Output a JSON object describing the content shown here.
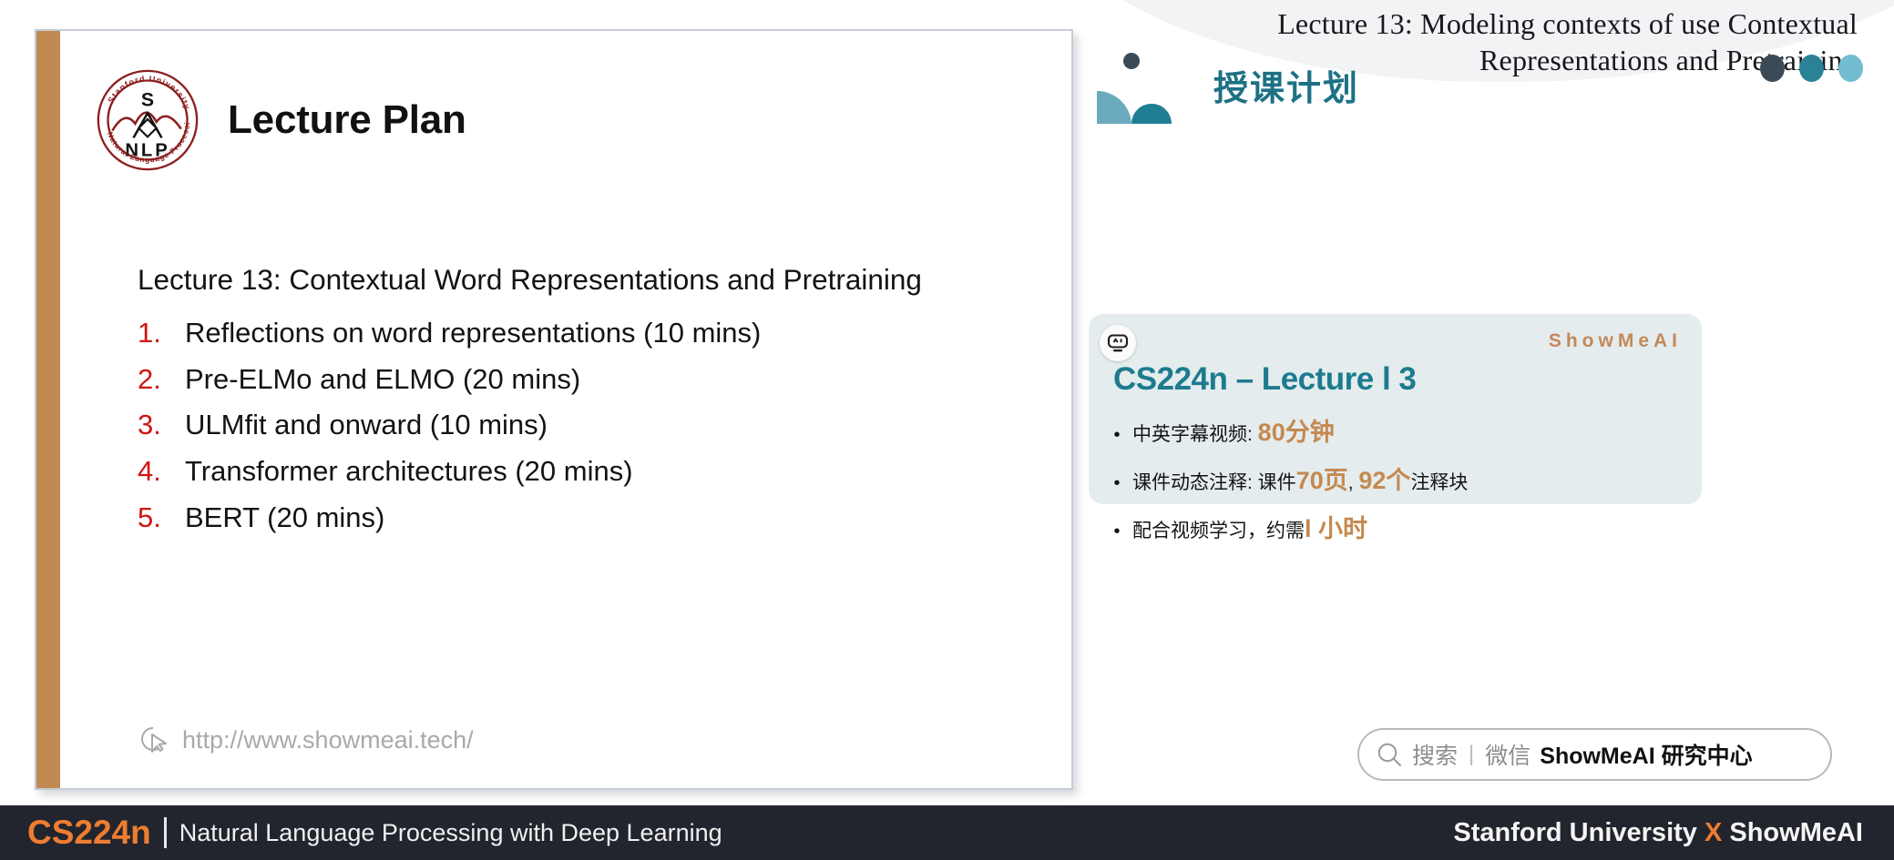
{
  "slide": {
    "title": "Lecture Plan",
    "logo_alt": "stanford-nlp-logo",
    "lead_line": "Lecture 13: Contextual Word Representations and Pretraining",
    "agenda": [
      {
        "num": "1.",
        "text": "Reflections on word representations (10 mins)"
      },
      {
        "num": "2.",
        "text": "Pre-ELMo and ELMO (20 mins)"
      },
      {
        "num": "3.",
        "text": "ULMfit and onward (10 mins)"
      },
      {
        "num": "4.",
        "text": "Transformer architectures (20 mins)"
      },
      {
        "num": "5.",
        "text": "BERT (20 mins)"
      }
    ],
    "url": "http://www.showmeai.tech/",
    "accent_color": "#c08a52"
  },
  "right_panel": {
    "header_title": "Lecture 13: Modeling contexts of use Contextual Representations and Pretraining",
    "section_title": "授课计划",
    "section_title_color": "#1d7185",
    "dots": [
      "#3a4a56",
      "#2b8296",
      "#72bdd0"
    ],
    "card": {
      "brand": "ShowMeAI",
      "brand_color": "#c4895a",
      "title": "CS224n – Lecture l 3",
      "title_color": "#1d7b8e",
      "background": "#e4ecee",
      "bullets": [
        {
          "bullet": "•",
          "parts": [
            {
              "text": "中英字幕视频: ",
              "highlight": false
            },
            {
              "text": "80分钟",
              "highlight": true
            }
          ]
        },
        {
          "bullet": "•",
          "parts": [
            {
              "text": "课件动态注释: 课件",
              "highlight": false
            },
            {
              "text": "70页",
              "highlight": true
            },
            {
              "text": ", ",
              "highlight": false
            },
            {
              "text": "92个",
              "highlight": true
            },
            {
              "text": "注释块",
              "highlight": false
            }
          ]
        },
        {
          "bullet": "•",
          "parts": [
            {
              "text": "配合视频学习，约需",
              "highlight": false
            },
            {
              "text": "l 小时",
              "highlight": true
            }
          ]
        }
      ]
    },
    "search": {
      "label": "搜索",
      "separator": "|",
      "channel": "微信",
      "account": "ShowMeAI 研究中心"
    }
  },
  "footer": {
    "course_code": "CS224n",
    "course_name": "Natural Language Processing with Deep Learning",
    "credit_left": "Stanford University",
    "credit_x": "X",
    "credit_right": "ShowMeAI",
    "accent_color": "#ed7d31"
  }
}
